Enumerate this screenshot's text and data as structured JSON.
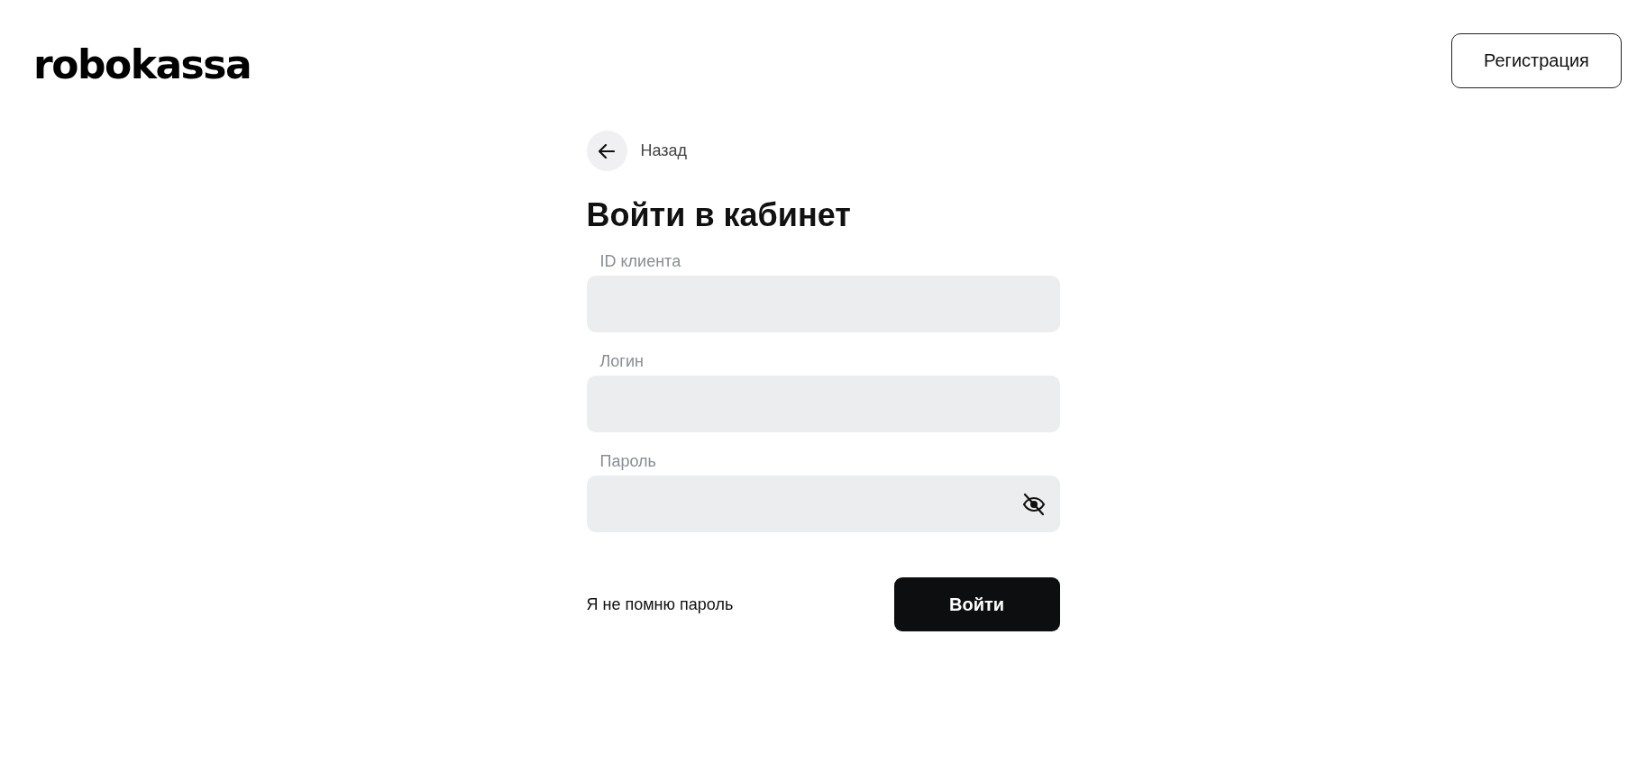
{
  "header": {
    "logo": "robokassa",
    "register_button": "Регистрация"
  },
  "back_link": "Назад",
  "title": "Войти в кабинет",
  "fields": [
    {
      "label": "ID клиента",
      "kind": "text"
    },
    {
      "label": "Логин",
      "kind": "text"
    },
    {
      "label": "Пароль",
      "kind": "password"
    }
  ],
  "forgot_link": "Я не помню пароль",
  "submit_button": "Войти"
}
